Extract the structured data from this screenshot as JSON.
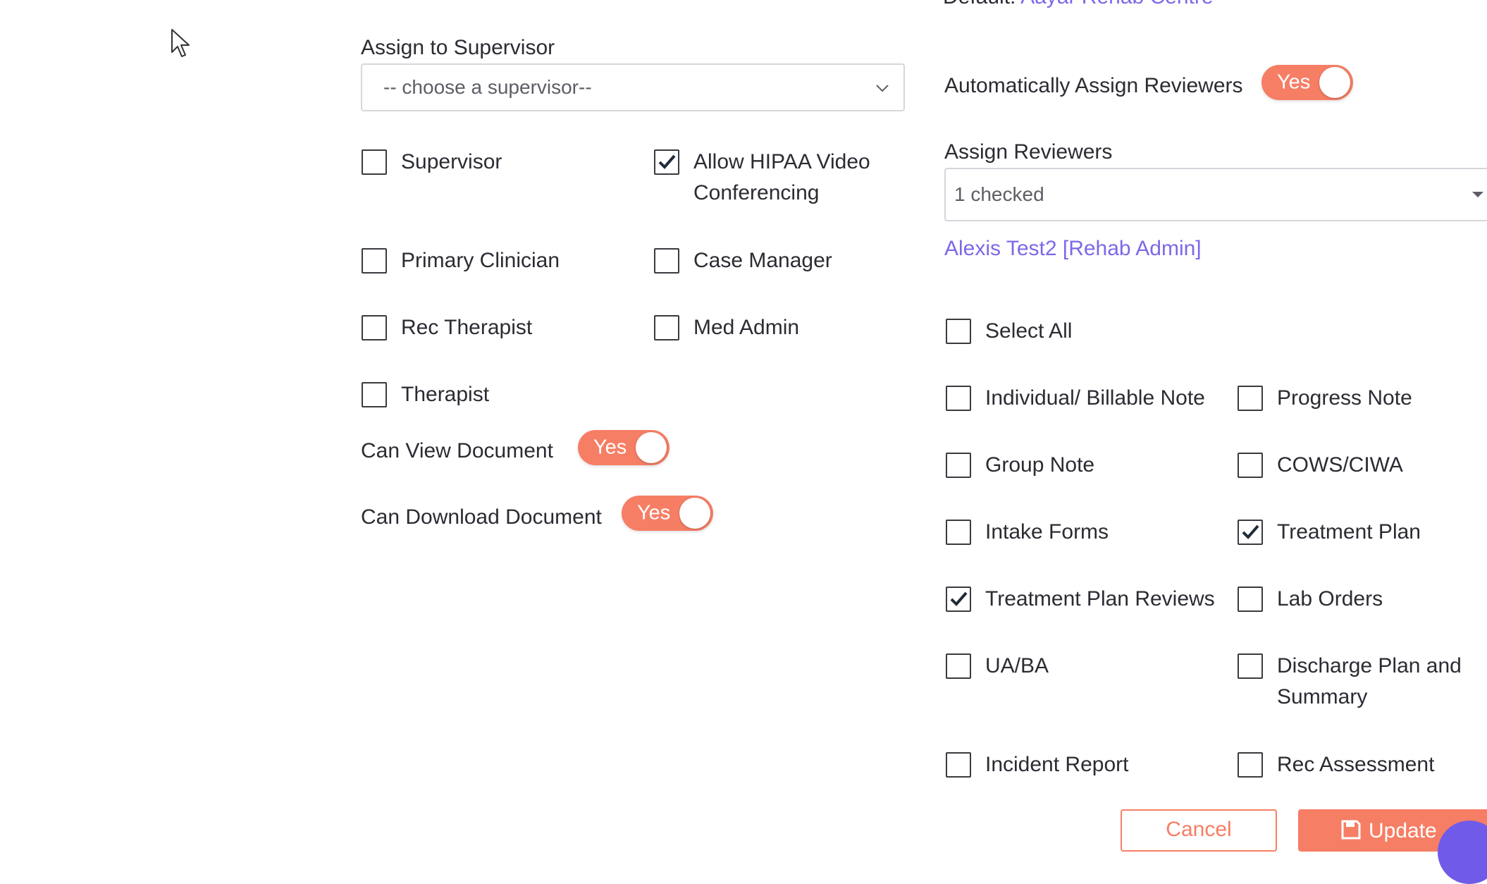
{
  "top_partial": {
    "label": "Default:",
    "link": "Aayar Rehab Centre"
  },
  "cursor_icon": "arrow-cursor-icon",
  "supervisor": {
    "label": "Assign to Supervisor",
    "placeholder": "-- choose a supervisor--"
  },
  "roles": [
    {
      "label": "Supervisor",
      "checked": false
    },
    {
      "label": "Allow HIPAA Video Conferencing",
      "checked": true
    },
    {
      "label": "Primary Clinician",
      "checked": false
    },
    {
      "label": "Case Manager",
      "checked": false
    },
    {
      "label": "Rec Therapist",
      "checked": false
    },
    {
      "label": "Med Admin",
      "checked": false
    },
    {
      "label": "Therapist",
      "checked": false
    }
  ],
  "can_view": {
    "label": "Can View Document",
    "toggle": "Yes"
  },
  "can_download": {
    "label": "Can Download Document",
    "toggle": "Yes"
  },
  "auto_assign": {
    "label": "Automatically Assign Reviewers",
    "toggle": "Yes"
  },
  "reviewers": {
    "label": "Assign Reviewers",
    "value": "1 checked",
    "selected_link": "Alexis Test2 [Rehab Admin]"
  },
  "doc_types": [
    {
      "label": "Select All",
      "checked": false
    },
    {
      "label": "Individual/ Billable Note",
      "checked": false
    },
    {
      "label": "Progress Note",
      "checked": false
    },
    {
      "label": "Group Note",
      "checked": false
    },
    {
      "label": "COWS/CIWA",
      "checked": false
    },
    {
      "label": "Intake Forms",
      "checked": false
    },
    {
      "label": "Treatment Plan",
      "checked": true
    },
    {
      "label": "Treatment Plan Reviews",
      "checked": true
    },
    {
      "label": "Lab Orders",
      "checked": false
    },
    {
      "label": "UA/BA",
      "checked": false
    },
    {
      "label": "Discharge Plan and Summary",
      "checked": false
    },
    {
      "label": "Incident Report",
      "checked": false
    },
    {
      "label": "Rec Assessment",
      "checked": false
    }
  ],
  "buttons": {
    "cancel": "Cancel",
    "update": "Update"
  },
  "colors": {
    "accent": "#f67e65",
    "link": "#7c68e8",
    "fab": "#6f5be8"
  }
}
